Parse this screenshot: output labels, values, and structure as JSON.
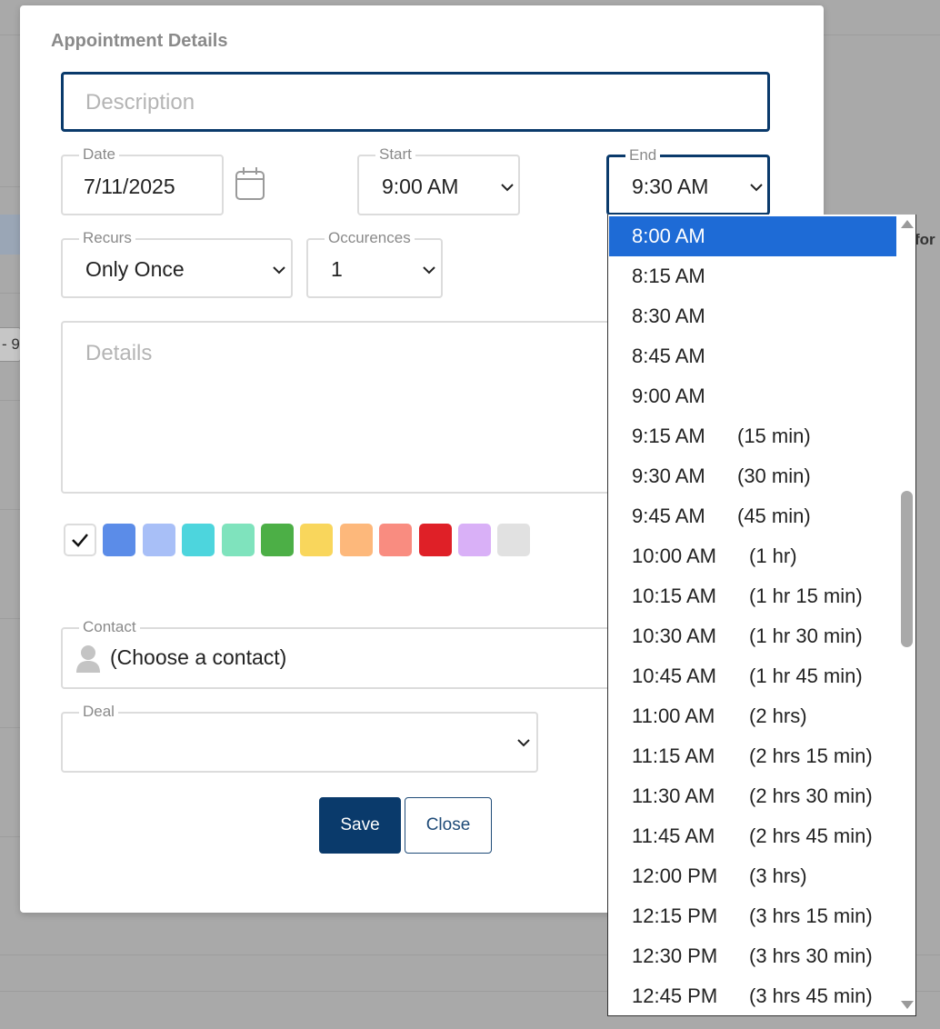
{
  "background": {
    "edge_chip_text": "- 9",
    "edge_right_text": "for"
  },
  "modal": {
    "title": "Appointment Details",
    "description": {
      "placeholder": "Description",
      "value": ""
    },
    "date": {
      "label": "Date",
      "value": "7/11/2025"
    },
    "start": {
      "label": "Start",
      "value": "9:00 AM"
    },
    "end": {
      "label": "End",
      "value": "9:30 AM"
    },
    "recurs": {
      "label": "Recurs",
      "value": "Only Once"
    },
    "occurences": {
      "label": "Occurences",
      "value": "1"
    },
    "details": {
      "placeholder": "Details"
    },
    "colors": [
      "#ffffff",
      "#5b8ce8",
      "#a8bff7",
      "#4dd5dd",
      "#7fe3bd",
      "#4caf46",
      "#f9d65c",
      "#fdb87b",
      "#f98c80",
      "#df2027",
      "#d9b0f7",
      "#e1e1e1"
    ],
    "contact": {
      "label": "Contact",
      "value": "(Choose a contact)"
    },
    "deal": {
      "label": "Deal",
      "value": ""
    },
    "buttons": {
      "save": "Save",
      "close": "Close"
    }
  },
  "end_dropdown": {
    "selected_index": 0,
    "options": [
      {
        "time": "8:00 AM",
        "duration": ""
      },
      {
        "time": "8:15 AM",
        "duration": ""
      },
      {
        "time": "8:30 AM",
        "duration": ""
      },
      {
        "time": "8:45 AM",
        "duration": ""
      },
      {
        "time": "9:00 AM",
        "duration": ""
      },
      {
        "time": "9:15 AM",
        "duration": "(15 min)"
      },
      {
        "time": "9:30 AM",
        "duration": "(30 min)"
      },
      {
        "time": "9:45 AM",
        "duration": "(45 min)"
      },
      {
        "time": "10:00 AM",
        "duration": "(1 hr)"
      },
      {
        "time": "10:15 AM",
        "duration": "(1 hr 15 min)"
      },
      {
        "time": "10:30 AM",
        "duration": "(1 hr 30 min)"
      },
      {
        "time": "10:45 AM",
        "duration": "(1 hr 45 min)"
      },
      {
        "time": "11:00 AM",
        "duration": "(2 hrs)"
      },
      {
        "time": "11:15 AM",
        "duration": "(2 hrs 15 min)"
      },
      {
        "time": "11:30 AM",
        "duration": "(2 hrs 30 min)"
      },
      {
        "time": "11:45 AM",
        "duration": "(2 hrs 45 min)"
      },
      {
        "time": "12:00 PM",
        "duration": "(3 hrs)"
      },
      {
        "time": "12:15 PM",
        "duration": "(3 hrs 15 min)"
      },
      {
        "time": "12:30 PM",
        "duration": "(3 hrs 30 min)"
      },
      {
        "time": "12:45 PM",
        "duration": "(3 hrs 45 min)"
      }
    ]
  }
}
